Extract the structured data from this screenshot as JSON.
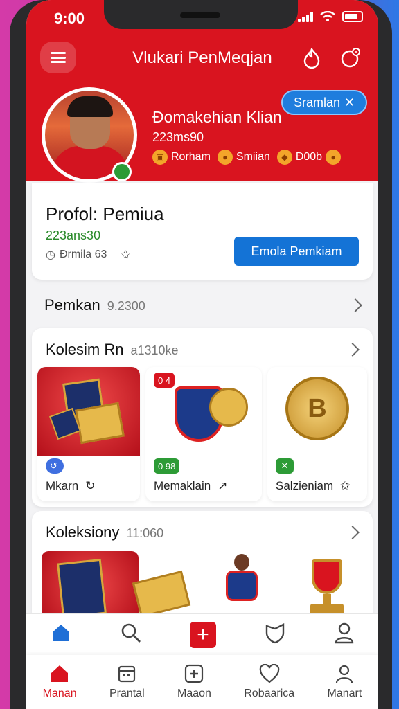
{
  "status": {
    "time": "9:00"
  },
  "header": {
    "title": "Vlukari PenMeqjan"
  },
  "profile": {
    "name": "Ðomakehian Klian",
    "id": "223ms90",
    "badges": [
      {
        "label": "Rorham",
        "icon": "trophy-icon"
      },
      {
        "label": "Smiian",
        "icon": "star-icon"
      },
      {
        "label": "Ð00b",
        "icon": "medal-icon"
      }
    ],
    "pill_label": "Sramlan"
  },
  "profile_card": {
    "title": "Profol: Pemiua",
    "id": "223ans30",
    "meta": "Ðrmila 63",
    "button": "Emola Pemkiam"
  },
  "section_players": {
    "title": "Pemkan",
    "sub": "9.2300"
  },
  "section_collection1": {
    "title": "Kolesim Rn",
    "sub": "a1310ke",
    "items": [
      {
        "label": "Mkarn",
        "tag": "",
        "tag_color": "#3f6fe0"
      },
      {
        "label": "Memaklain",
        "tag": "0 98",
        "tag_color": "#2d9b36",
        "tag2": "0 4"
      },
      {
        "label": "Salzieniam",
        "tag": "",
        "tag_color": "#2d9b36"
      }
    ]
  },
  "section_collection2": {
    "title": "Koleksiony",
    "sub": "11:060"
  },
  "nav_top": [
    {
      "icon": "home-icon"
    },
    {
      "icon": "search-icon"
    },
    {
      "icon": "plus-icon"
    },
    {
      "icon": "shield-icon"
    },
    {
      "icon": "profile-icon"
    }
  ],
  "nav_bottom": [
    {
      "label": "Manan",
      "icon": "home-icon",
      "active": true
    },
    {
      "label": "Prantal",
      "icon": "calendar-icon",
      "active": false
    },
    {
      "label": "Maaon",
      "icon": "add-icon",
      "active": false
    },
    {
      "label": "Robaarica",
      "icon": "heart-icon",
      "active": false
    },
    {
      "label": "Manart",
      "icon": "user-icon",
      "active": false
    }
  ],
  "colors": {
    "brand": "#d9141f",
    "accent": "#1473d6"
  }
}
